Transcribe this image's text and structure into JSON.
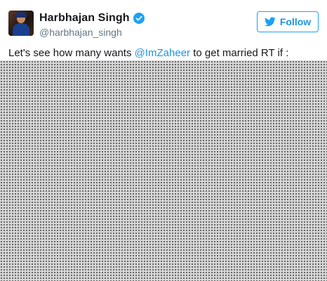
{
  "user": {
    "display_name": "Harbhajan Singh",
    "handle": "@harbhajan_singh",
    "verified": true
  },
  "follow_button": {
    "label": "Follow"
  },
  "tweet": {
    "text_before": "Let's see how many wants ",
    "mention": "@ImZaheer",
    "text_after": " to get married RT if :"
  },
  "colors": {
    "link": "#1b95e0",
    "brand": "#1da1f2",
    "text": "#14171a",
    "handle": "#657786"
  }
}
